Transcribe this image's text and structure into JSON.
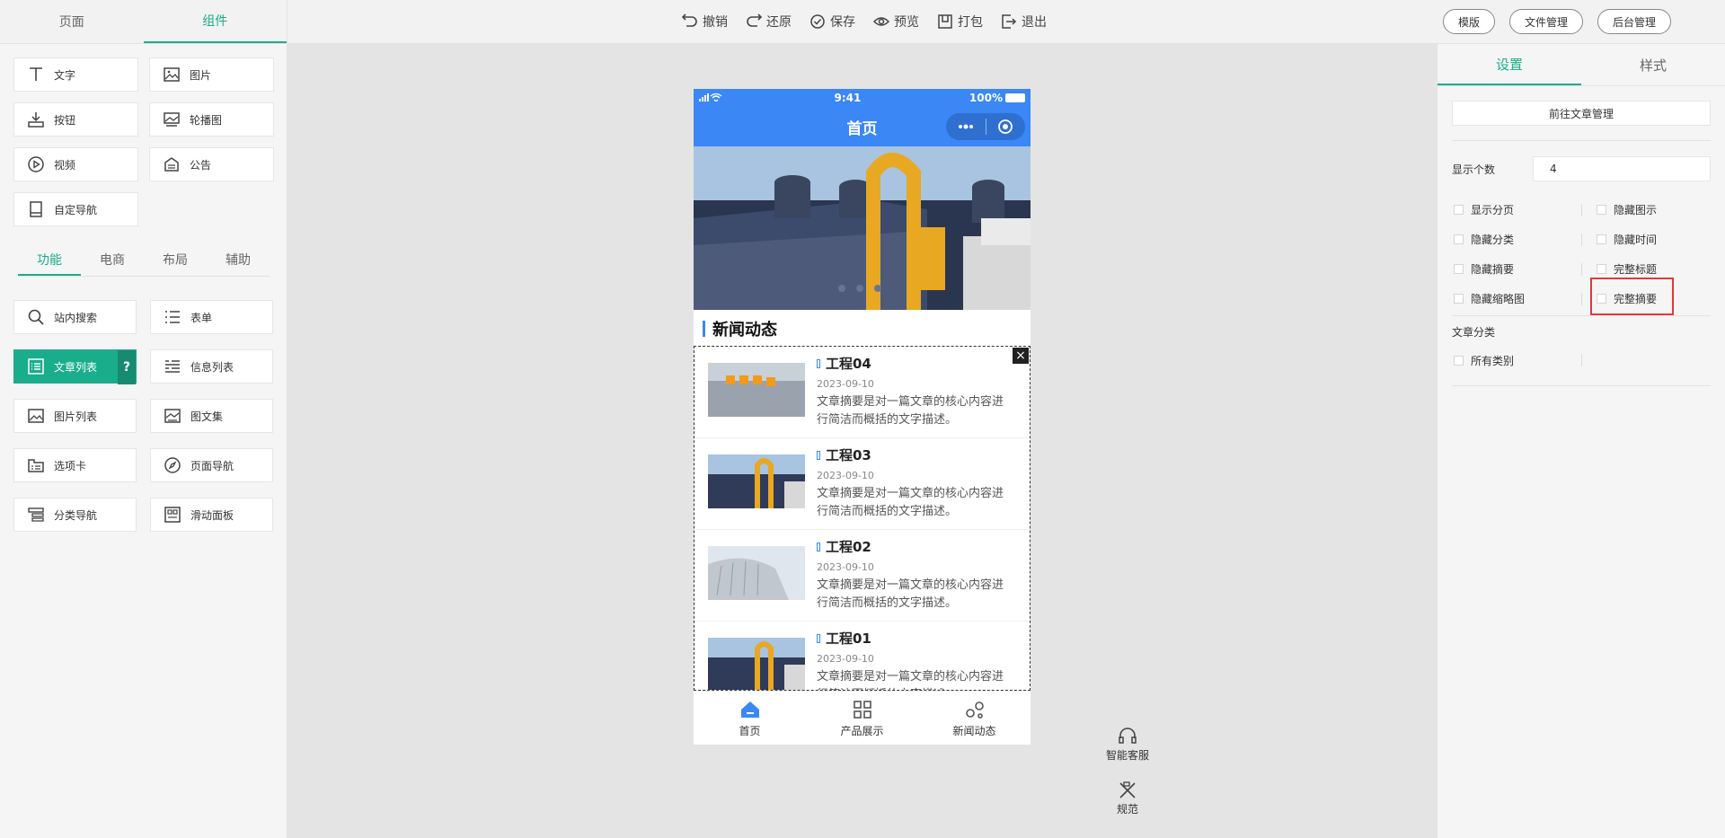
{
  "top": {
    "left_tabs": [
      "页面",
      "组件"
    ],
    "toolbar": [
      "撤销",
      "还原",
      "保存",
      "预览",
      "打包",
      "退出"
    ],
    "right_buttons": [
      "模版",
      "文件管理",
      "后台管理"
    ]
  },
  "left": {
    "basic": [
      "文字",
      "图片",
      "按钮",
      "轮播图",
      "视频",
      "公告",
      "自定导航"
    ],
    "func_tabs": [
      "功能",
      "电商",
      "布局",
      "辅助"
    ],
    "func_items": [
      "站内搜索",
      "表单",
      "文章列表",
      "信息列表",
      "图片列表",
      "图文集",
      "选项卡",
      "页面导航",
      "分类导航",
      "滑动面板"
    ],
    "help": "?"
  },
  "phone": {
    "status": {
      "time": "9:41",
      "battery": "100%"
    },
    "nav_title": "首页",
    "section_title": "新闻动态",
    "articles": [
      {
        "title": "工程04",
        "date": "2023-09-10",
        "summary": "文章摘要是对一篇文章的核心内容进行简洁而概括的文字描述。"
      },
      {
        "title": "工程03",
        "date": "2023-09-10",
        "summary": "文章摘要是对一篇文章的核心内容进行简洁而概括的文字描述。"
      },
      {
        "title": "工程02",
        "date": "2023-09-10",
        "summary": "文章摘要是对一篇文章的核心内容进行简洁而概括的文字描述。"
      },
      {
        "title": "工程01",
        "date": "2023-09-10",
        "summary": "文章摘要是对一篇文章的核心内容进行简洁而概括的文字描述。"
      }
    ],
    "tabbar": [
      "首页",
      "产品展示",
      "新闻动态"
    ],
    "close": "×"
  },
  "float": {
    "service": "智能客服",
    "spec": "规范"
  },
  "right": {
    "tabs": [
      "设置",
      "样式"
    ],
    "goto": "前往文章管理",
    "count_label": "显示个数",
    "count_value": "4",
    "options": [
      [
        "显示分页",
        "隐藏图示"
      ],
      [
        "隐藏分类",
        "隐藏时间"
      ],
      [
        "隐藏摘要",
        "完整标题"
      ],
      [
        "隐藏缩略图",
        "完整摘要"
      ]
    ],
    "cat_label": "文章分类",
    "cat_option": "所有类别"
  },
  "colors": {
    "accent": "#1aad8c",
    "phone_blue": "#3a87f5",
    "highlight": "#e03a3a"
  }
}
